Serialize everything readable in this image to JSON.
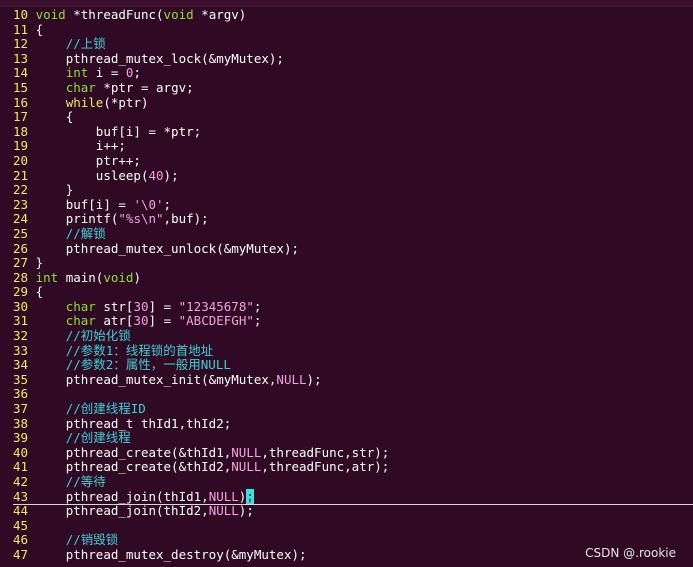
{
  "terminal": {
    "watermark": "CSDN @.rookie",
    "colors": {
      "background": "#300a24",
      "line_number": "#eeee55",
      "type": "#8ae234",
      "keyword": "#eeee55",
      "comment": "#3ad1d6",
      "string": "#f2a1e1",
      "constant": "#f2a1e1",
      "text": "#ffffff",
      "cursor": "#34e2e2"
    },
    "cursor_line": 43,
    "lines": [
      {
        "n": "10",
        "tokens": [
          [
            "ty",
            "void"
          ],
          [
            "pl",
            " *threadFunc("
          ],
          [
            "ty",
            "void"
          ],
          [
            "pl",
            " *argv)"
          ]
        ]
      },
      {
        "n": "11",
        "tokens": [
          [
            "pl",
            "{"
          ]
        ]
      },
      {
        "n": "12",
        "tokens": [
          [
            "pl",
            "    "
          ],
          [
            "cm",
            "//上锁"
          ]
        ]
      },
      {
        "n": "13",
        "tokens": [
          [
            "pl",
            "    pthread_mutex_lock(&myMutex);"
          ]
        ]
      },
      {
        "n": "14",
        "tokens": [
          [
            "pl",
            "    "
          ],
          [
            "ty",
            "int"
          ],
          [
            "pl",
            " i = "
          ],
          [
            "nm",
            "0"
          ],
          [
            "pl",
            ";"
          ]
        ]
      },
      {
        "n": "15",
        "tokens": [
          [
            "pl",
            "    "
          ],
          [
            "ty",
            "char"
          ],
          [
            "pl",
            " *ptr = argv;"
          ]
        ]
      },
      {
        "n": "16",
        "tokens": [
          [
            "pl",
            "    "
          ],
          [
            "kw",
            "while"
          ],
          [
            "pl",
            "(*ptr)"
          ]
        ]
      },
      {
        "n": "17",
        "tokens": [
          [
            "pl",
            "    {"
          ]
        ]
      },
      {
        "n": "18",
        "tokens": [
          [
            "pl",
            "        buf[i] = *ptr;"
          ]
        ]
      },
      {
        "n": "19",
        "tokens": [
          [
            "pl",
            "        i++;"
          ]
        ]
      },
      {
        "n": "20",
        "tokens": [
          [
            "pl",
            "        ptr++;"
          ]
        ]
      },
      {
        "n": "21",
        "tokens": [
          [
            "pl",
            "        usleep("
          ],
          [
            "nm",
            "40"
          ],
          [
            "pl",
            ");"
          ]
        ]
      },
      {
        "n": "22",
        "tokens": [
          [
            "pl",
            "    }"
          ]
        ]
      },
      {
        "n": "23",
        "tokens": [
          [
            "pl",
            "    buf[i] = "
          ],
          [
            "st",
            "'\\0'"
          ],
          [
            "pl",
            ";"
          ]
        ]
      },
      {
        "n": "24",
        "tokens": [
          [
            "pl",
            "    printf("
          ],
          [
            "st",
            "\"%s\\n\""
          ],
          [
            "pl",
            ",buf);"
          ]
        ]
      },
      {
        "n": "25",
        "tokens": [
          [
            "pl",
            "    "
          ],
          [
            "cm",
            "//解锁"
          ]
        ]
      },
      {
        "n": "26",
        "tokens": [
          [
            "pl",
            "    pthread_mutex_unlock(&myMutex);"
          ]
        ]
      },
      {
        "n": "27",
        "tokens": [
          [
            "pl",
            "}"
          ]
        ]
      },
      {
        "n": "28",
        "tokens": [
          [
            "ty",
            "int"
          ],
          [
            "pl",
            " main("
          ],
          [
            "ty",
            "void"
          ],
          [
            "pl",
            ")"
          ]
        ]
      },
      {
        "n": "29",
        "tokens": [
          [
            "pl",
            "{"
          ]
        ]
      },
      {
        "n": "30",
        "tokens": [
          [
            "pl",
            "    "
          ],
          [
            "ty",
            "char"
          ],
          [
            "pl",
            " str["
          ],
          [
            "nm",
            "30"
          ],
          [
            "pl",
            "] = "
          ],
          [
            "st",
            "\"12345678\""
          ],
          [
            "pl",
            ";"
          ]
        ]
      },
      {
        "n": "31",
        "tokens": [
          [
            "pl",
            "    "
          ],
          [
            "ty",
            "char"
          ],
          [
            "pl",
            " atr["
          ],
          [
            "nm",
            "30"
          ],
          [
            "pl",
            "] = "
          ],
          [
            "st",
            "\"ABCDEFGH\""
          ],
          [
            "pl",
            ";"
          ]
        ]
      },
      {
        "n": "32",
        "tokens": [
          [
            "pl",
            "    "
          ],
          [
            "cm",
            "//初始化锁"
          ]
        ]
      },
      {
        "n": "33",
        "tokens": [
          [
            "pl",
            "    "
          ],
          [
            "cm",
            "//参数1：线程锁的首地址"
          ]
        ]
      },
      {
        "n": "34",
        "tokens": [
          [
            "pl",
            "    "
          ],
          [
            "cm",
            "//参数2：属性，一般用NULL"
          ]
        ]
      },
      {
        "n": "35",
        "tokens": [
          [
            "pl",
            "    pthread_mutex_init(&myMutex,"
          ],
          [
            "cx",
            "NULL"
          ],
          [
            "pl",
            ");"
          ]
        ]
      },
      {
        "n": "36",
        "tokens": []
      },
      {
        "n": "37",
        "tokens": [
          [
            "pl",
            "    "
          ],
          [
            "cm",
            "//创建线程ID"
          ]
        ]
      },
      {
        "n": "38",
        "tokens": [
          [
            "pl",
            "    pthread_t thId1,thId2;"
          ]
        ]
      },
      {
        "n": "39",
        "tokens": [
          [
            "pl",
            "    "
          ],
          [
            "cm",
            "//创建线程"
          ]
        ]
      },
      {
        "n": "40",
        "tokens": [
          [
            "pl",
            "    pthread_create(&thId1,"
          ],
          [
            "cx",
            "NULL"
          ],
          [
            "pl",
            ",threadFunc,str);"
          ]
        ]
      },
      {
        "n": "41",
        "tokens": [
          [
            "pl",
            "    pthread_create(&thId2,"
          ],
          [
            "cx",
            "NULL"
          ],
          [
            "pl",
            ",threadFunc,atr);"
          ]
        ]
      },
      {
        "n": "42",
        "tokens": [
          [
            "pl",
            "    "
          ],
          [
            "cm",
            "//等待"
          ]
        ]
      },
      {
        "n": "43",
        "tokens": [
          [
            "pl",
            "    pthread_join(thId1,"
          ],
          [
            "cx",
            "NULL"
          ],
          [
            "pl",
            ")"
          ],
          [
            "cursor",
            ";"
          ]
        ]
      },
      {
        "n": "44",
        "tokens": [
          [
            "pl",
            "    pthread_join(thId2,"
          ],
          [
            "cx",
            "NULL"
          ],
          [
            "pl",
            ");"
          ]
        ]
      },
      {
        "n": "45",
        "tokens": []
      },
      {
        "n": "46",
        "tokens": [
          [
            "pl",
            "    "
          ],
          [
            "cm",
            "//销毁锁"
          ]
        ]
      },
      {
        "n": "47",
        "tokens": [
          [
            "pl",
            "    pthread_mutex_destroy(&myMutex);"
          ]
        ]
      }
    ]
  }
}
